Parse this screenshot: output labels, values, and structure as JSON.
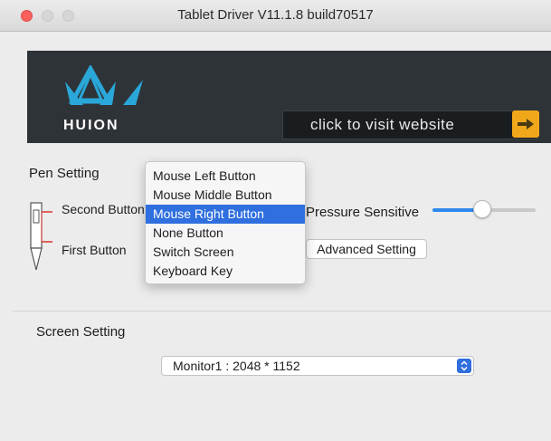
{
  "window": {
    "title": "Tablet Driver V11.1.8 build70517"
  },
  "banner": {
    "brand": "HUION",
    "visit_text": "click to visit website",
    "icons": {
      "logo": "huion-crown-logo",
      "visit": "right-arrow-icon"
    },
    "colors": {
      "logo_accent": "#2aa7d9",
      "button": "#f0a81a"
    }
  },
  "pen_setting": {
    "title": "Pen Setting",
    "second_button_label": "Second Button",
    "first_button_label": "First Button",
    "pressure_label": "Pressure Sensitive",
    "pressure_level_fraction": 0.47,
    "advanced_button": "Advanced Setting",
    "dropdown": {
      "options": [
        "Mouse Left Button",
        "Mouse Middle Button",
        "Mouse Right Button",
        "None Button",
        "Switch Screen",
        "Keyboard Key"
      ],
      "selected": "Mouse Right Button"
    }
  },
  "screen_setting": {
    "title": "Screen Setting",
    "monitor_selected": "Monitor1 : 2048 * 1152"
  },
  "accent_color": "#2f6fdf"
}
